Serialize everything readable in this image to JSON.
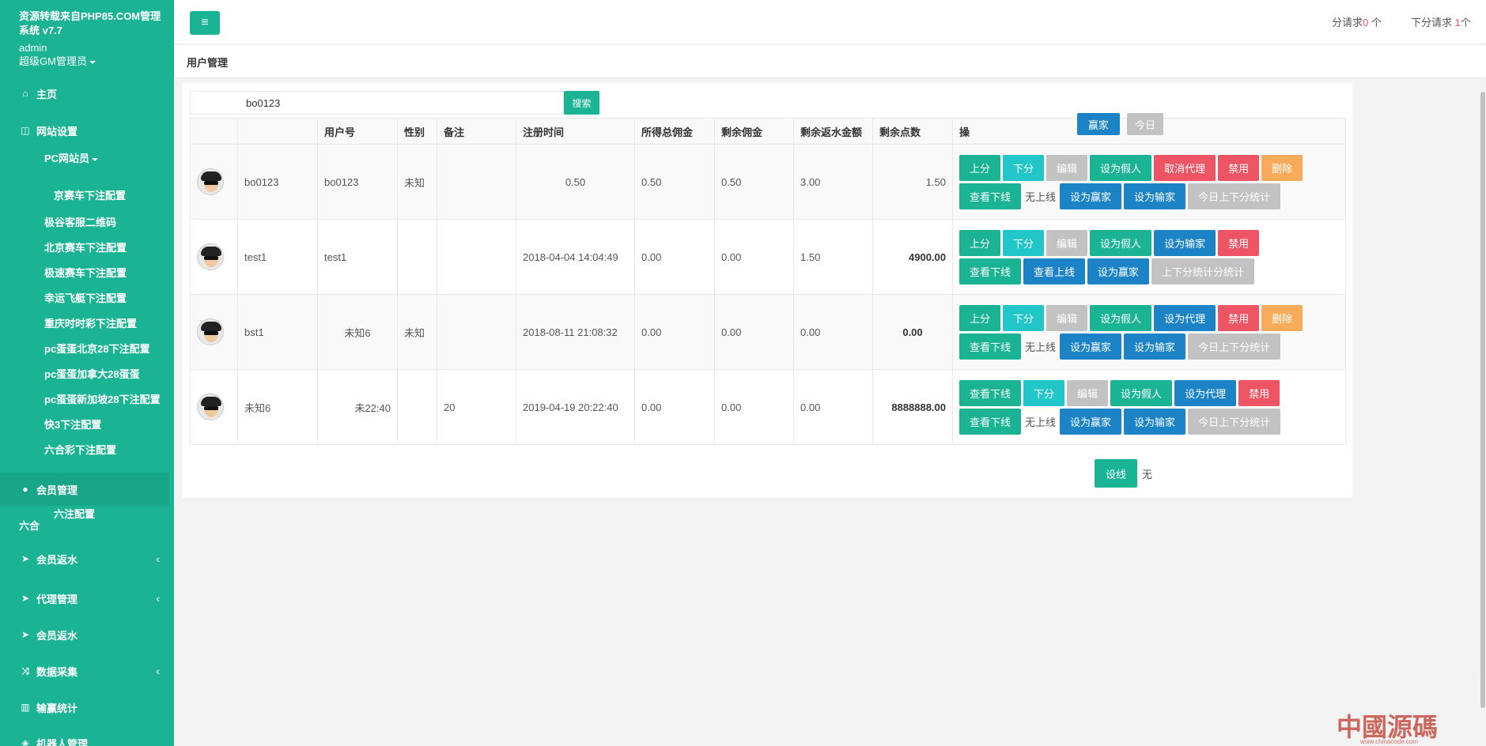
{
  "sidebar": {
    "title": "资源转载来自PHP85.COM管理系统 v7.7",
    "user": "admin",
    "role": "超级GM管理员",
    "items": [
      {
        "label": "主页",
        "icon": "home-icon"
      },
      {
        "label": "网站设置",
        "icon": "columns-icon"
      },
      {
        "label": "会员管理",
        "icon": "user-icon"
      },
      {
        "label": "会员返水",
        "icon": "paper-plane-icon"
      },
      {
        "label": "代理管理",
        "icon": "paper-plane-icon"
      },
      {
        "label": "会员返水",
        "icon": "paper-plane-icon"
      },
      {
        "label": "数据采集",
        "icon": "shuffle-icon"
      },
      {
        "label": "输赢统计",
        "icon": "bar-chart-icon"
      },
      {
        "label": "机器人管理",
        "icon": "robot-icon"
      }
    ],
    "subitems": [
      "PC网站员",
      "京赛车下注配置",
      "极谷客服二维码",
      "北京赛车下注配置",
      "极速赛车下注配置",
      "幸运飞艇下注配置",
      "重庆时时彩下注配置",
      "pc蛋蛋北京28下注配置",
      "pc蛋蛋加拿大28蛋蛋",
      "pc蛋蛋新加坡28下注配置",
      "快3下注配置",
      "六合彩下注配置",
      "六注配置",
      "六合"
    ]
  },
  "topbar": {
    "req_label": "分请求",
    "req_count": "0",
    "req_unit": "个",
    "down_label": "下分请求",
    "down_count": "1",
    "down_unit": "个"
  },
  "breadcrumb": "用户管理",
  "search": {
    "value": "bo0123",
    "button": "搜索"
  },
  "table": {
    "headers": [
      "",
      "",
      "用户号",
      "性别",
      "备注",
      "注册时间",
      "所得总佣金",
      "剩余佣金",
      "剩余返水金额",
      "剩余点数",
      "操"
    ],
    "rows": [
      {
        "name": "bo0123",
        "user": "bo0123",
        "gender": "未知",
        "note": "",
        "reg": "0.50",
        "total": "0.50",
        "remain": "0.50",
        "rebate": "3.00",
        "points": "1.50"
      },
      {
        "name": "test1",
        "user": "test1",
        "gender": "",
        "note": "",
        "reg": "2018-04-04 14:04:49",
        "total": "0.00",
        "remain": "0.00",
        "rebate": "1.50",
        "points": "4900.00"
      },
      {
        "name": "bst1",
        "user": "未知6",
        "gender": "未知",
        "note": "",
        "reg": "2018-08-11 21:08:32",
        "total": "0.00",
        "remain": "0.00",
        "rebate": "0.00",
        "points": "0.00"
      },
      {
        "name": "未知6",
        "user": "未22:40",
        "gender": "",
        "note": "20",
        "reg": "2019-04-19 20:22:40",
        "total": "0.00",
        "remain": "0.00",
        "rebate": "0.00",
        "points": "8888888.00"
      }
    ]
  },
  "ops_header": {
    "win": "赢家",
    "today": "今日"
  },
  "buttons": {
    "up": "上分",
    "down": "下分",
    "edit": "编辑",
    "fake": "设为假人",
    "cancel_agent": "取消代理",
    "set_agent": "设为代理",
    "ban": "禁用",
    "del": "删除",
    "view_down": "查看下线",
    "view_up": "查看上线",
    "no_up": "无上线",
    "win": "设为赢家",
    "lose": "设为输家",
    "stats": "今日上下分统计",
    "stats2": "上下分统计分统计",
    "set_line": "设线",
    "none": "无"
  },
  "watermark": {
    "text": "中國源碼",
    "url": "www.chinacode.com"
  }
}
